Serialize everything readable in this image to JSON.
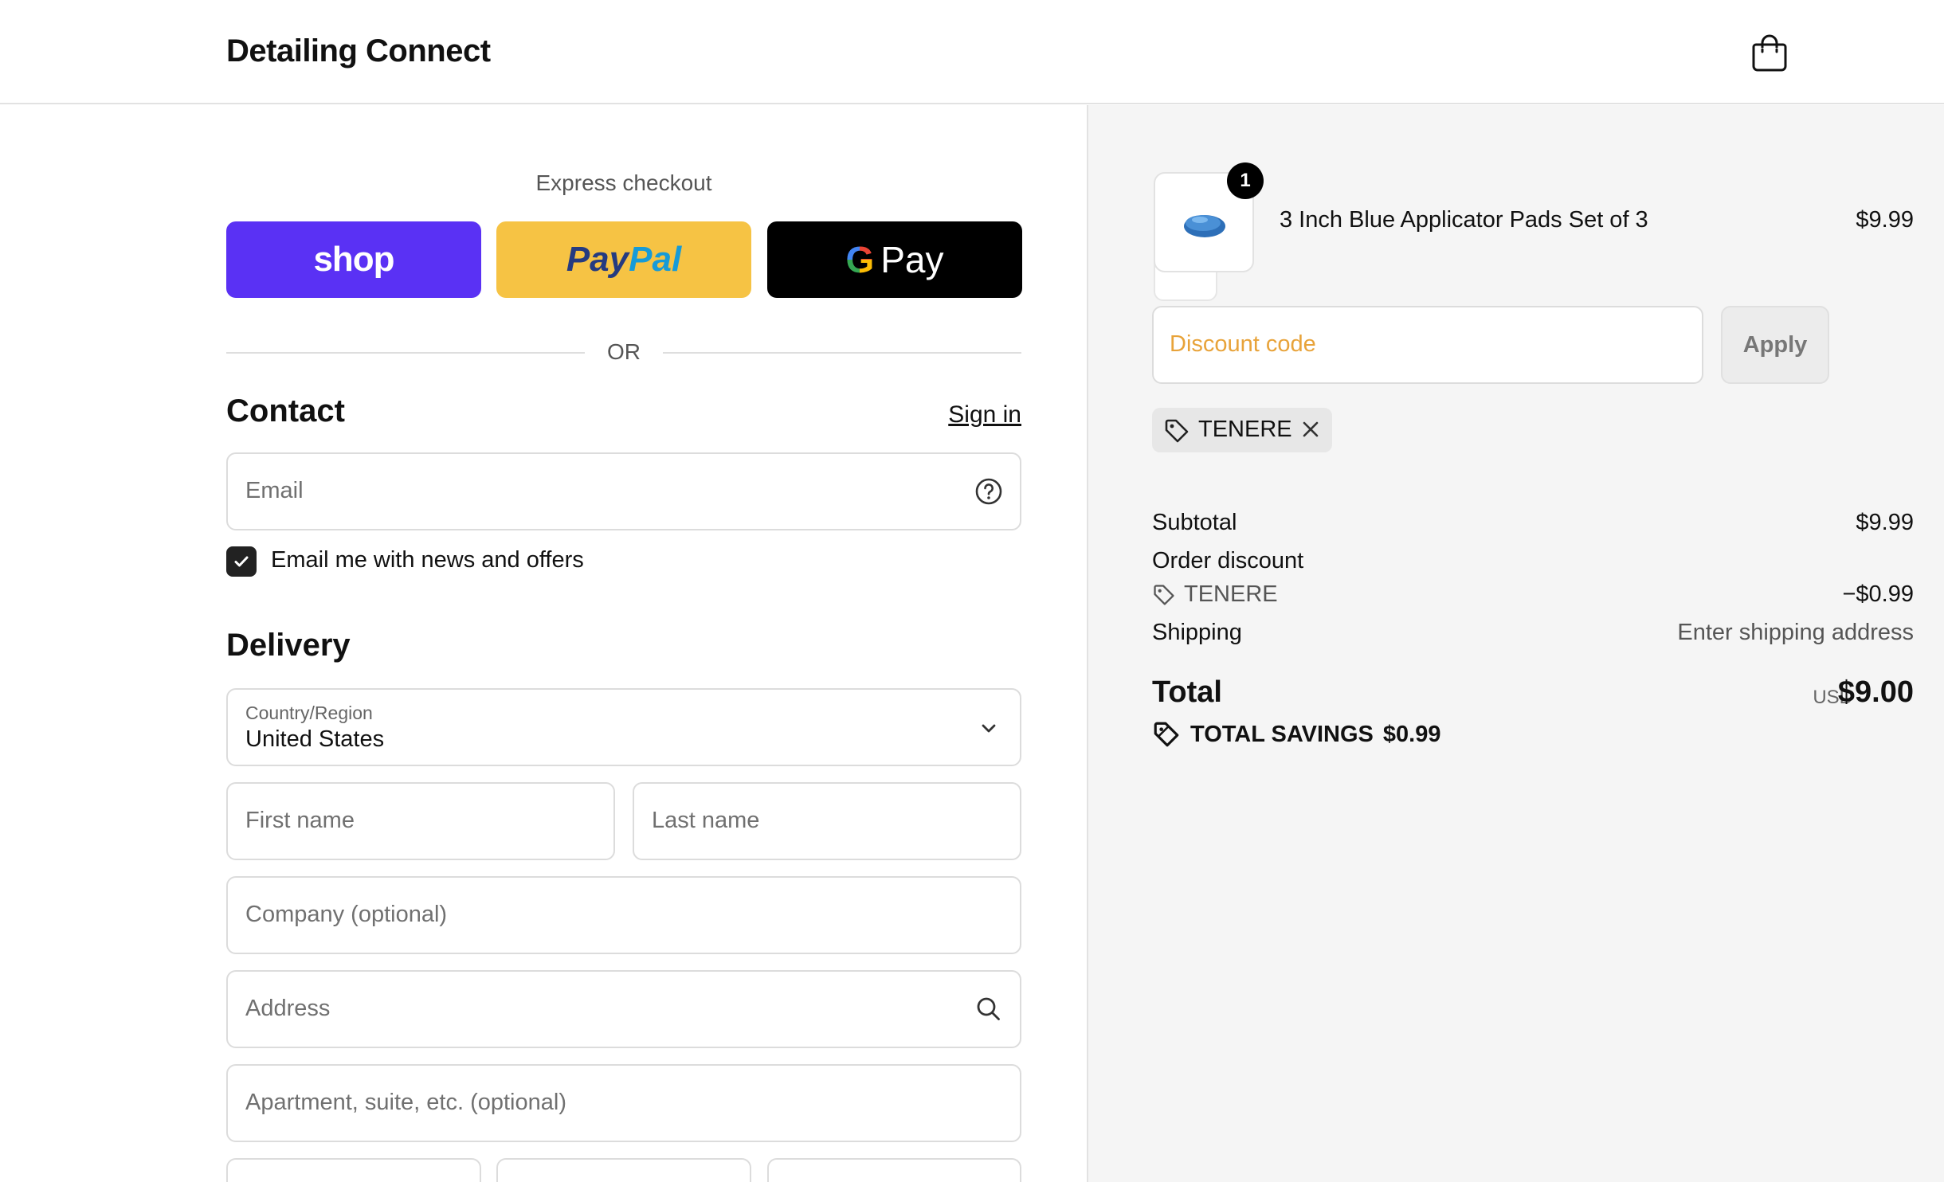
{
  "header": {
    "brand": "Detailing Connect",
    "cart_icon": "bag-icon"
  },
  "express": {
    "title": "Express checkout",
    "shop_label": "shop",
    "paypal_label_pay": "Pay",
    "paypal_label_pal": "Pal",
    "gpay_g": "G",
    "gpay_label": "Pay",
    "or_label": "OR"
  },
  "contact": {
    "title": "Contact",
    "sign_in": "Sign in",
    "email_placeholder": "Email",
    "help_icon": "question-circle-icon",
    "newsletter_label": "Email me with news and offers",
    "newsletter_checked": true
  },
  "delivery": {
    "title": "Delivery",
    "country_label": "Country/Region",
    "country_value": "United States",
    "first_name_placeholder": "First name",
    "last_name_placeholder": "Last name",
    "company_placeholder": "Company (optional)",
    "address_placeholder": "Address",
    "apartment_placeholder": "Apartment, suite, etc. (optional)"
  },
  "order": {
    "item": {
      "name": "3 Inch Blue Applicator Pads Set of 3",
      "price": "$9.99",
      "quantity": "1"
    },
    "discount_placeholder": "Discount code",
    "apply_label": "Apply",
    "applied_code": "TENERE",
    "subtotal_label": "Subtotal",
    "subtotal_value": "$9.99",
    "order_discount_label": "Order discount",
    "discount_code_label": "TENERE",
    "discount_value": "−$0.99",
    "shipping_label": "Shipping",
    "shipping_value": "Enter shipping address",
    "total_label": "Total",
    "total_currency": "USD",
    "total_value": "$9.00",
    "savings_label": "TOTAL SAVINGS",
    "savings_value": "$0.99"
  },
  "colors": {
    "shop": "#5a31f4",
    "paypal": "#f6c344",
    "gpay": "#000000",
    "discount_placeholder": "#e8a33a"
  }
}
